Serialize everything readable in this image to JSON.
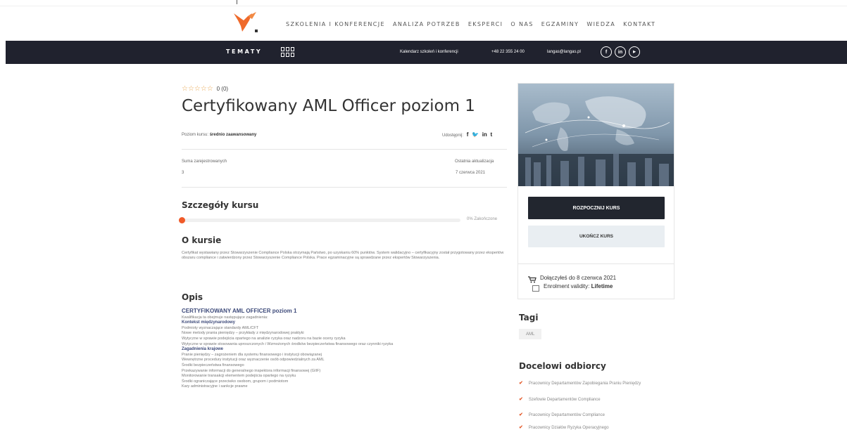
{
  "header": {
    "nav": [
      "SZKOLENIA I KONFERENCJE",
      "ANALIZA POTRZEB",
      "EKSPERCI",
      "O NAS",
      "EGZAMINY",
      "WIEDZA",
      "KONTAKT"
    ]
  },
  "topbar": {
    "topics": "TEMATY",
    "calendar": "Kalendarz szkoleń i konferencji",
    "phone": "+48 22 355 24 00",
    "email": "langas@langas.pl",
    "social": [
      "f",
      "in",
      "▶"
    ]
  },
  "course": {
    "stars": "☆☆☆☆☆",
    "rating": "0 (0)",
    "title": "Certyfikowany AML Officer poziom 1",
    "level_label": "Poziom kursu:",
    "level_value": "średnio zaawansowany",
    "share_label": "Udostępnij:",
    "share_icons": [
      "f",
      "🐦",
      "in",
      "t"
    ],
    "enrolled_label": "Suma zarejestrowanych",
    "enrolled_value": "3",
    "updated_label": "Ostatnia aktualizacja",
    "updated_value": "7 czerwca 2021",
    "details_heading": "Szczegóły kursu",
    "progress_percent": 0,
    "progress_label": "0% Zakończone",
    "about_heading": "O kursie",
    "about_text": "Certyfikat wystawiany przez Stowarzyszenie Compliance Polska otrzymają Państwo, po uzyskaniu 60% punktów. System walidacyjno – certyfikacyjny został przygotowany przez ekspertów obszaru compliance i zatwierdzony przez Stowarzyszenie Compliance Polska. Prace egzaminacyjne są sprawdzane przez ekspertów Stowarzyszenia.",
    "description_heading": "Opis",
    "description_lines": [
      {
        "text": "CERTYFIKOWANY AML OFFICER poziom 1",
        "style": "big"
      },
      {
        "text": "Kwalifikacja ta obejmuje następujące zagadnienia:",
        "style": "normal"
      },
      {
        "text": "Kontekst międzynarodowy",
        "style": "bold"
      },
      {
        "text": "Podmioty wyznaczające standardy AML/CFT",
        "style": "normal"
      },
      {
        "text": "Nowe metody prania pieniędzy – przykłady z międzynarodowej praktyki",
        "style": "normal"
      },
      {
        "text": "Wytyczne w sprawie podejścia opartego na analizie ryzyka oraz nadzoru na bazie oceny ryzyka",
        "style": "normal"
      },
      {
        "text": "Wytyczne w sprawie stosowania uproszczonych i Wzmożonych środków bezpieczeństwa finansowego oraz czynniki ryzyka",
        "style": "normal"
      },
      {
        "text": "Zagadnienia krajowe",
        "style": "bold"
      },
      {
        "text": "Pranie pieniędzy – zagrożeniem dla systemu finansowego i instytucji obowiązanej",
        "style": "normal"
      },
      {
        "text": "Wewnętrzne procedury instytucji oraz wyznaczenie osób odpowiedzialnych za AML",
        "style": "normal"
      },
      {
        "text": "Środki bezpieczeństwa finansowego",
        "style": "normal"
      },
      {
        "text": "Przekazywanie informacji do generalnego inspektora informacji finansowej (GIIF)",
        "style": "normal"
      },
      {
        "text": "Monitorowanie transakcji elementem podejścia opartego na ryzyku",
        "style": "normal"
      },
      {
        "text": "Środki ograniczające przeciwko osobom, grupom i podmiotom",
        "style": "normal"
      },
      {
        "text": "Kary administracyjne i sankcje prawne",
        "style": "normal"
      }
    ]
  },
  "sidebar": {
    "start_button": "ROZPOCZNIJ KURS",
    "finish_button": "UKOŃCZ KURS",
    "joined": "Dołączyłeś do 8 czerwca 2021",
    "validity_label": "Enrolment validity:",
    "validity_value": "Lifetime",
    "tags_heading": "Tagi",
    "tags": [
      "AML"
    ],
    "audience_heading": "Docelowi odbiorcy",
    "audience": [
      "Pracownicy Departamentów Zapobiegania Praniu Pieniędzy",
      "Szefowie Departamentów Compliance",
      "Pracownicy Departamentów Compliance",
      "Pracownicy Działów Ryzyka Operacyjnego"
    ]
  },
  "colors": {
    "dark_bar": "#20222e",
    "accent_orange": "#f05a28",
    "star": "#e8a44b",
    "link_blue": "#3d4a7a"
  }
}
